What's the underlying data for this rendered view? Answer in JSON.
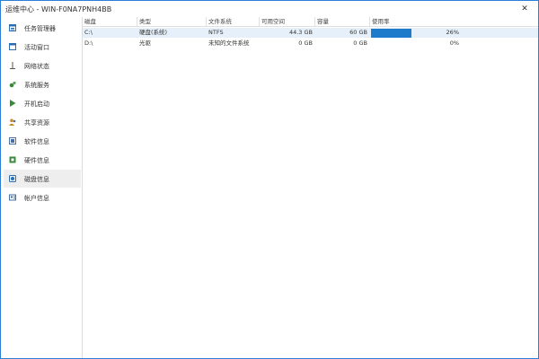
{
  "window": {
    "title": "运维中心 - WIN-F0NA7PNH4BB",
    "close_glyph": "✕"
  },
  "sidebar": {
    "active_index": 8,
    "items": [
      {
        "label": "任务管理器",
        "icon": "task-manager-icon",
        "color": "#2a6fb5"
      },
      {
        "label": "活动窗口",
        "icon": "window-icon",
        "color": "#2a6fb5"
      },
      {
        "label": "网络状态",
        "icon": "network-icon",
        "color": "#555555"
      },
      {
        "label": "系统服务",
        "icon": "gears-icon",
        "color": "#3a8a3a"
      },
      {
        "label": "开机启动",
        "icon": "play-icon",
        "color": "#3a8a3a"
      },
      {
        "label": "共享资源",
        "icon": "users-icon",
        "color": "#c78a2a"
      },
      {
        "label": "软件信息",
        "icon": "software-icon",
        "color": "#4a6fa5"
      },
      {
        "label": "硬件信息",
        "icon": "chip-icon",
        "color": "#3a8a3a"
      },
      {
        "label": "磁盘信息",
        "icon": "disk-icon",
        "color": "#2a6fb5"
      },
      {
        "label": "帐户信息",
        "icon": "account-icon",
        "color": "#4a6fa5"
      }
    ]
  },
  "table": {
    "columns": [
      "磁盘",
      "类型",
      "文件系统",
      "可用空间",
      "容量",
      "使用率"
    ],
    "rows": [
      {
        "disk": "C:\\",
        "type": "硬盘(系统)",
        "fs": "NTFS",
        "free": "44.3 GB",
        "capacity": "60 GB",
        "usage_text": "26%",
        "usage_fraction": 0.26,
        "selected": true
      },
      {
        "disk": "D:\\",
        "type": "光驱",
        "fs": "未知的文件系统",
        "free": "0 GB",
        "capacity": "0 GB",
        "usage_text": "0%",
        "usage_fraction": 0.0,
        "selected": false
      }
    ]
  },
  "colors": {
    "accent": "#2b7fd6",
    "usage_bar": "#1e7acb",
    "selected_row": "#e6f0fa",
    "active_nav": "#eeeeee"
  }
}
